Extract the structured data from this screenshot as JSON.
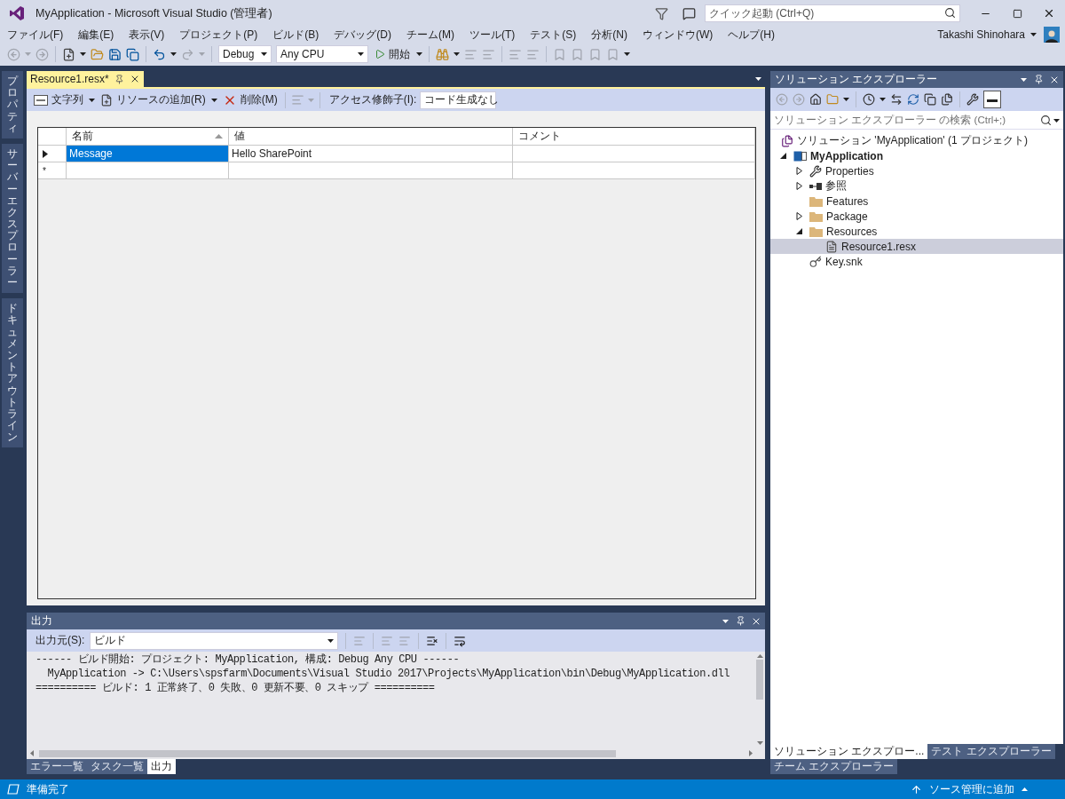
{
  "window": {
    "title": "MyApplication - Microsoft Visual Studio (管理者)",
    "quick_launch": {
      "placeholder": "クイック起動 (Ctrl+Q)"
    },
    "user": "Takashi Shinohara"
  },
  "menu": [
    "ファイル(F)",
    "編集(E)",
    "表示(V)",
    "プロジェクト(P)",
    "ビルド(B)",
    "デバッグ(D)",
    "チーム(M)",
    "ツール(T)",
    "テスト(S)",
    "分析(N)",
    "ウィンドウ(W)",
    "ヘルプ(H)"
  ],
  "toolbar": {
    "configuration": "Debug",
    "platform": "Any CPU",
    "start": "開始"
  },
  "side_tabs": [
    "プロパティ",
    "サーバーエクスプローラー",
    "ドキュメントアウトライン"
  ],
  "document_tabs": [
    {
      "label": "Resource1.resx*",
      "selected": true
    }
  ],
  "resource_toolbar": {
    "type": "文字列",
    "add": "リソースの追加(R)",
    "delete": "削除(M)",
    "access_label": "アクセス修飾子(I):",
    "access_value": "コード生成なし"
  },
  "grid": {
    "columns": [
      "名前",
      "値",
      "コメント"
    ],
    "rows": [
      {
        "name": "Message",
        "value": "Hello SharePoint",
        "selected": true
      }
    ],
    "new_row_marker": "*"
  },
  "output": {
    "title": "出力",
    "source_label": "出力元(S):",
    "source": "ビルド",
    "lines": [
      "------ ビルド開始: プロジェクト: MyApplication, 構成: Debug Any CPU ------",
      "  MyApplication -> C:\\Users\\spsfarm\\Documents\\Visual Studio 2017\\Projects\\MyApplication\\bin\\Debug\\MyApplication.dll",
      "========== ビルド: 1 正常終了、0 失敗、0 更新不要、0 スキップ =========="
    ]
  },
  "bottom_tabs": [
    {
      "label": "エラー一覧",
      "selected": false
    },
    {
      "label": "タスク一覧",
      "selected": false
    },
    {
      "label": "出力",
      "selected": true
    }
  ],
  "solution_explorer": {
    "title": "ソリューション エクスプローラー",
    "search": {
      "placeholder": "ソリューション エクスプローラー の検索 (Ctrl+;)"
    },
    "tree": [
      {
        "label": "ソリューション 'MyApplication' (1 プロジェクト)",
        "kind": "solution",
        "selected": false,
        "children": [
          {
            "label": "MyApplication",
            "kind": "project",
            "selected": false,
            "expanded": true,
            "children": [
              {
                "label": "Properties",
                "kind": "properties",
                "selected": false,
                "expanded": false
              },
              {
                "label": "参照",
                "kind": "references",
                "selected": false,
                "expanded": false
              },
              {
                "label": "Features",
                "kind": "folder",
                "selected": false
              },
              {
                "label": "Package",
                "kind": "folder",
                "selected": false,
                "expanded": false
              },
              {
                "label": "Resources",
                "kind": "folder",
                "selected": false,
                "expanded": true,
                "children": [
                  {
                    "label": "Resource1.resx",
                    "kind": "file",
                    "selected": true
                  }
                ]
              },
              {
                "label": "Key.snk",
                "kind": "key",
                "selected": false
              }
            ]
          }
        ]
      }
    ]
  },
  "right_tabs": [
    {
      "label": "ソリューション エクスプロー...",
      "selected": true
    },
    {
      "label": "テスト エクスプローラー",
      "selected": false
    },
    {
      "label": "チーム エクスプローラー",
      "selected": false
    }
  ],
  "status_bar": {
    "message": "準備完了",
    "source_control": "ソース管理に追加"
  }
}
